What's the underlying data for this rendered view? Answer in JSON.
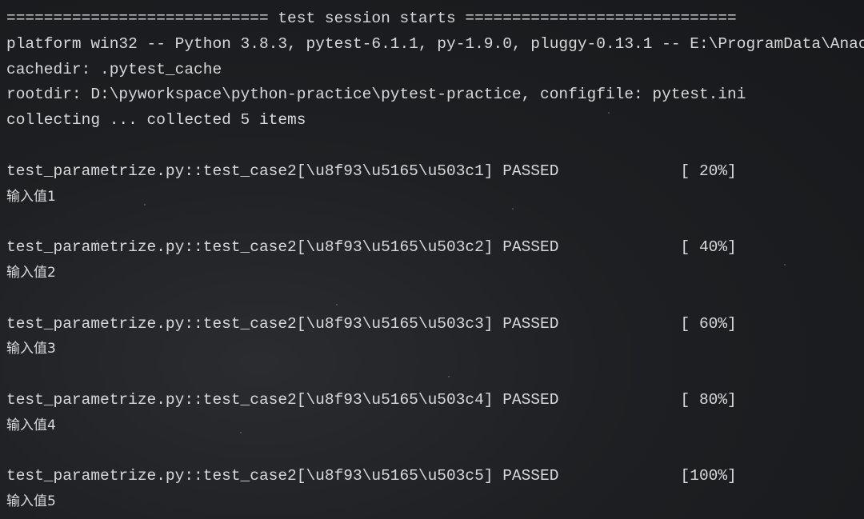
{
  "terminal": {
    "header": "============================ test session starts =============================",
    "platform": "platform win32 -- Python 3.8.3, pytest-6.1.1, py-1.9.0, pluggy-0.13.1 -- E:\\ProgramData\\Anac",
    "cachedir": "cachedir: .pytest_cache",
    "rootdir": "rootdir: D:\\pyworkspace\\python-practice\\pytest-practice, configfile: pytest.ini",
    "collecting": "collecting ... collected 5 items",
    "tests": [
      {
        "line": "test_parametrize.py::test_case2[\\u8f93\\u5165\\u503c1] PASSED             [ 20%]",
        "output": "输入值1"
      },
      {
        "line": "test_parametrize.py::test_case2[\\u8f93\\u5165\\u503c2] PASSED             [ 40%]",
        "output": "输入值2"
      },
      {
        "line": "test_parametrize.py::test_case2[\\u8f93\\u5165\\u503c3] PASSED             [ 60%]",
        "output": "输入值3"
      },
      {
        "line": "test_parametrize.py::test_case2[\\u8f93\\u5165\\u503c4] PASSED             [ 80%]",
        "output": "输入值4"
      },
      {
        "line": "test_parametrize.py::test_case2[\\u8f93\\u5165\\u503c5] PASSED             [100%]",
        "output": "输入值5"
      }
    ]
  }
}
